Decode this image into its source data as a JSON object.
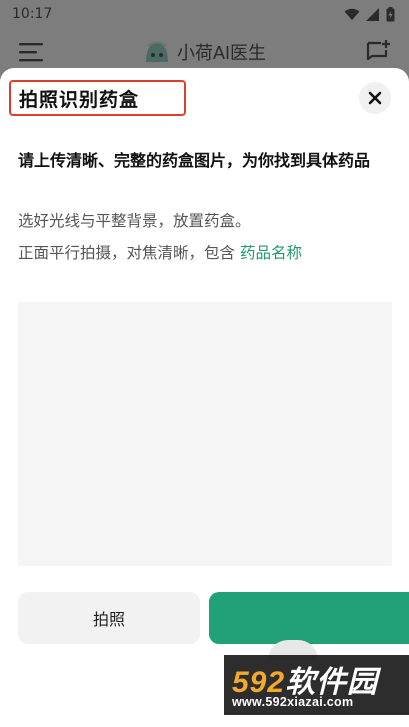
{
  "status_bar": {
    "time": "10:17",
    "icons": [
      "wifi-icon",
      "signal-icon",
      "battery-icon"
    ]
  },
  "app_header": {
    "title": "小荷AI医生",
    "icons": [
      "menu-icon",
      "logo-icon",
      "new-chat-icon"
    ]
  },
  "sheet": {
    "title": "拍照识别药盒",
    "close_icon": "close-icon",
    "instruction_bold": "请上传清晰、完整的药盒图片，为你找到具体药品",
    "instruction_line1": "选好光线与平整背景，放置药盒。",
    "instruction_line2_prefix": "正面平行拍摄，对焦清晰，包含",
    "instruction_line2_highlight": "药品名称"
  },
  "buttons": {
    "photo_label": "拍照"
  },
  "watermark": {
    "logo_num": "592",
    "logo_cn": "软件园",
    "url": "www.592xiazai.com"
  },
  "colors": {
    "accent": "#21a179",
    "highlight_text": "#1f9a6e",
    "annotation_red": "#d9412b"
  }
}
